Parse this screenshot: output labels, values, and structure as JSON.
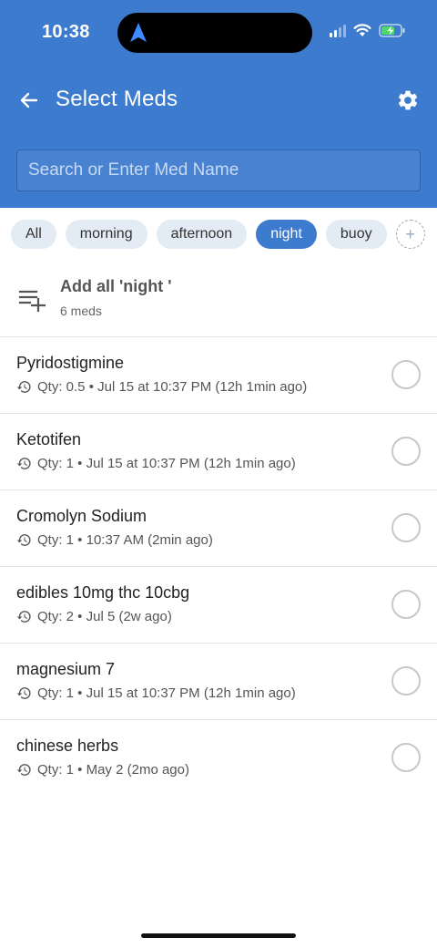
{
  "status_bar": {
    "time": "10:38"
  },
  "header": {
    "title": "Select Meds",
    "back_icon": "arrow-left-icon",
    "settings_icon": "gear-icon"
  },
  "search": {
    "placeholder": "Search or Enter Med Name",
    "value": ""
  },
  "chips": [
    {
      "label": "All",
      "active": false
    },
    {
      "label": "morning",
      "active": false
    },
    {
      "label": "afternoon",
      "active": false
    },
    {
      "label": "night",
      "active": true
    },
    {
      "label": "buoy",
      "active": false
    }
  ],
  "add_all": {
    "title": "Add all 'night '",
    "count": "6 meds",
    "icon": "playlist-add-icon"
  },
  "meds": [
    {
      "name": "Pyridostigmine",
      "meta": "Qty: 0.5 • Jul 15 at 10:37 PM (12h 1min ago)",
      "selected": false
    },
    {
      "name": "Ketotifen",
      "meta": "Qty: 1 • Jul 15 at 10:37 PM (12h 1min ago)",
      "selected": false
    },
    {
      "name": "Cromolyn Sodium",
      "meta": "Qty: 1 • 10:37 AM (2min ago)",
      "selected": false
    },
    {
      "name": "edibles 10mg thc 10cbg",
      "meta": "Qty: 2 • Jul 5 (2w ago)",
      "selected": false
    },
    {
      "name": "magnesium 7",
      "meta": "Qty: 1 • Jul 15 at 10:37 PM (12h 1min ago)",
      "selected": false
    },
    {
      "name": "chinese herbs",
      "meta": "Qty: 1 • May 2 (2mo ago)",
      "selected": false
    }
  ],
  "colors": {
    "header": "#3d7bcf",
    "chip_active": "#3d7bcf",
    "chip_inactive": "#e3ebf5"
  }
}
